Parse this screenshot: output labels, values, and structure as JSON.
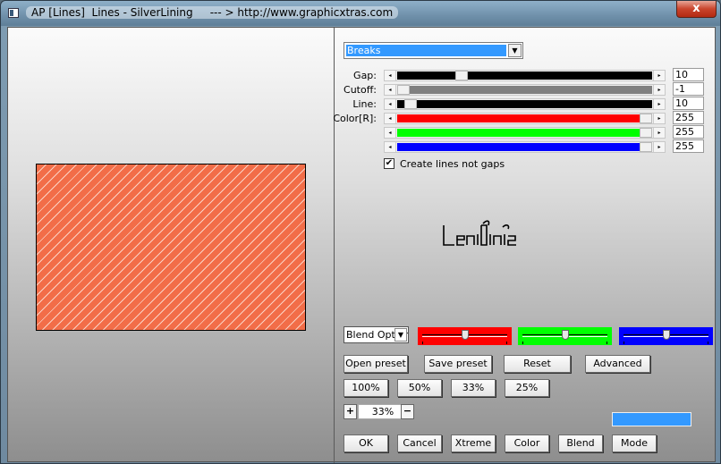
{
  "window": {
    "title": "AP [Lines]  Lines - SilverLining     --- > http://www.graphicxtras.com",
    "close_label": "x"
  },
  "effect_dropdown": {
    "selected": "Breaks",
    "arrow": "▼"
  },
  "sliders": [
    {
      "label": "Gap:",
      "value": "10",
      "fill_color": "#000000",
      "level": 0.24
    },
    {
      "label": "Cutoff:",
      "value": "-1",
      "fill_color": "#808080",
      "level": 0.0
    },
    {
      "label": "Line:",
      "value": "10",
      "fill_color": "#000000",
      "level": 0.03
    },
    {
      "label": "Color[R]:",
      "value": "255",
      "fill_color": "#ff0000",
      "level": 1.0
    },
    {
      "label": "",
      "value": "255",
      "fill_color": "#00ff00",
      "level": 1.0
    },
    {
      "label": "",
      "value": "255",
      "fill_color": "#0000ff",
      "level": 1.0
    }
  ],
  "slider_arrows": {
    "left": "◂",
    "right": "▸"
  },
  "checkbox": {
    "label": "Create lines not gaps",
    "checked": true,
    "mark": "✔"
  },
  "logo": {
    "text": "LeniDini2"
  },
  "blend": {
    "dropdown_text": "Blend Option",
    "arrow": "▼",
    "channels": [
      {
        "color": "#ff0000",
        "level": 0.5
      },
      {
        "color": "#00ff00",
        "level": 0.5
      },
      {
        "color": "#0000ff",
        "level": 0.5
      }
    ]
  },
  "preset_buttons": {
    "open": "Open preset",
    "save": "Save preset",
    "reset": "Reset",
    "advanced": "Advanced"
  },
  "zoom_buttons": {
    "z100": "100%",
    "z50": "50%",
    "z33": "33%",
    "z25": "25%"
  },
  "zoom": {
    "plus": "+",
    "value": "33%",
    "minus": "−"
  },
  "swatch_color": "#3399ff",
  "bottom_buttons": {
    "ok": "OK",
    "cancel": "Cancel",
    "xtreme": "Xtreme",
    "color": "Color",
    "blend": "Blend",
    "mode": "Mode"
  },
  "preview": {
    "base_color": "#f26d48",
    "line_color": "#fbd2c3"
  }
}
